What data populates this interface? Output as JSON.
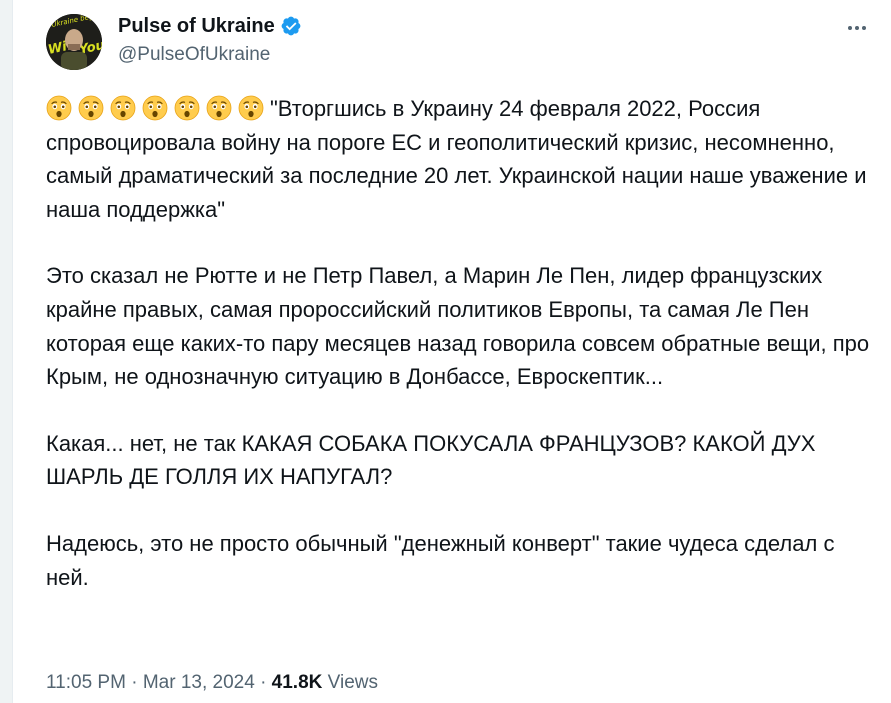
{
  "author": {
    "display_name": "Pulse of Ukraine",
    "handle": "@PulseOfUkraine",
    "avatar_text": "Ukraine begins with you",
    "verified_icon": "verified-badge-icon",
    "colors": {
      "verified": "#1d9bf0",
      "handle": "#536471",
      "text": "#0f1419"
    }
  },
  "more_icon": "more-horizontal-icon",
  "emoji": {
    "name": "astonished-face-emoji",
    "count": 7
  },
  "paragraphs": [
    "\"Вторгшись в Украину 24 февраля 2022, Россия спровоцировала войну на пороге ЕС и геополитический кризис, несомненно, самый драматический за последние 20 лет. Украинской нации наше уважение и наша поддержка\"",
    "Это сказал не Рютте и не Петр Павел, а Марин Ле Пен, лидер французских крайне правых, самая  пророссийский политиков Европы, та самая Ле Пен которая еще каких-то пару месяцев назад говорила совсем обратные вещи, про Крым, не однозначную ситуацию в Донбассе, Евроскептик...",
    "Какая... нет, не так КАКАЯ СОБАКА ПОКУСАЛА ФРАНЦУЗОВ? КАКОЙ ДУХ ШАРЛЬ ДЕ ГОЛЛЯ ИХ НАПУГАЛ?",
    "Надеюсь, это не просто обычный \"денежный конверт\" такие чудеса сделал с ней."
  ],
  "meta": {
    "time": "11:05 PM",
    "separator": "·",
    "date": "Mar 13, 2024",
    "views_count": "41.8K",
    "views_label": "Views"
  }
}
